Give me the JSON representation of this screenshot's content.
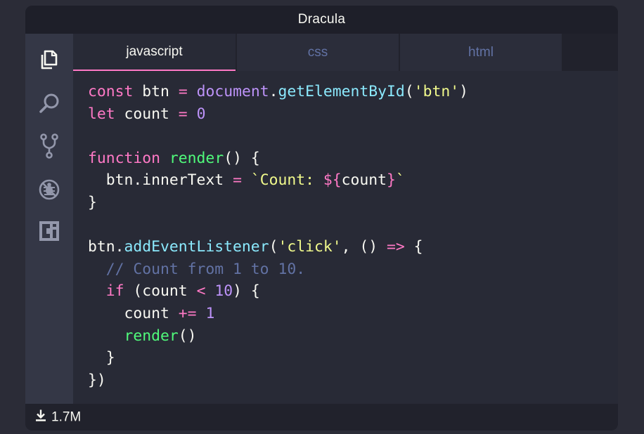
{
  "window": {
    "title": "Dracula"
  },
  "activity_bar": {
    "icons": [
      "files-icon",
      "search-icon",
      "source-control-icon",
      "debug-icon",
      "extensions-icon"
    ]
  },
  "tabs": [
    {
      "label": "javascript",
      "active": true
    },
    {
      "label": "css",
      "active": false
    },
    {
      "label": "html",
      "active": false
    }
  ],
  "code": {
    "lines": [
      [
        [
          "k",
          "const"
        ],
        [
          "p",
          " btn "
        ],
        [
          "o",
          "="
        ],
        [
          "p",
          " "
        ],
        [
          "n",
          "document"
        ],
        [
          "p",
          "."
        ],
        [
          "m",
          "getElementById"
        ],
        [
          "p",
          "("
        ],
        [
          "s",
          "'btn'"
        ],
        [
          "p",
          ")"
        ]
      ],
      [
        [
          "k",
          "let"
        ],
        [
          "p",
          " count "
        ],
        [
          "o",
          "="
        ],
        [
          "p",
          " "
        ],
        [
          "n",
          "0"
        ]
      ],
      [],
      [
        [
          "k",
          "function"
        ],
        [
          "p",
          " "
        ],
        [
          "f",
          "render"
        ],
        [
          "p",
          "() {"
        ]
      ],
      [
        [
          "p",
          "  btn.innerText "
        ],
        [
          "o",
          "="
        ],
        [
          "p",
          " "
        ],
        [
          "s",
          "`Count: "
        ],
        [
          "k",
          "${"
        ],
        [
          "p",
          "count"
        ],
        [
          "k",
          "}"
        ],
        [
          "s",
          "`"
        ]
      ],
      [
        [
          "p",
          "}"
        ]
      ],
      [],
      [
        [
          "p",
          "btn."
        ],
        [
          "m",
          "addEventListener"
        ],
        [
          "p",
          "("
        ],
        [
          "s",
          "'click'"
        ],
        [
          "p",
          ", () "
        ],
        [
          "o",
          "=>"
        ],
        [
          "p",
          " {"
        ]
      ],
      [
        [
          "c",
          "  // Count from 1 to 10."
        ]
      ],
      [
        [
          "p",
          "  "
        ],
        [
          "k",
          "if"
        ],
        [
          "p",
          " (count "
        ],
        [
          "o",
          "<"
        ],
        [
          "p",
          " "
        ],
        [
          "n",
          "10"
        ],
        [
          "p",
          ") {"
        ]
      ],
      [
        [
          "p",
          "    count "
        ],
        [
          "o",
          "+="
        ],
        [
          "p",
          " "
        ],
        [
          "n",
          "1"
        ]
      ],
      [
        [
          "p",
          "    "
        ],
        [
          "f",
          "render"
        ],
        [
          "p",
          "()"
        ]
      ],
      [
        [
          "p",
          "  }"
        ]
      ],
      [
        [
          "p",
          "})"
        ]
      ]
    ]
  },
  "status": {
    "icon": "download-icon",
    "text": "1.7M"
  },
  "colors": {
    "background": "#282a36",
    "foreground": "#f8f8f2",
    "pink": "#ff79c6",
    "green": "#50fa7b",
    "cyan": "#8be9fd",
    "yellow": "#f1fa8c",
    "purple": "#bd93f9",
    "comment": "#6272a4"
  }
}
